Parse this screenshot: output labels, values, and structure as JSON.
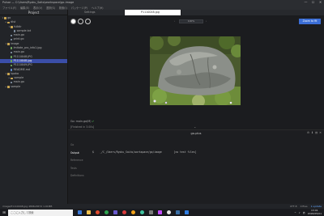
{
  "window": {
    "title": "Pulsar — C:\\Users\\Ryoku_Saito\\workspace\\go-image",
    "minimize": "—",
    "maximize": "☐",
    "close": "✕"
  },
  "menu": [
    "ファイル(F)",
    "編集(E)",
    "表示(V)",
    "選択(S)",
    "検索(I)",
    "パッケージ(P)",
    "ヘルプ(H)"
  ],
  "sidebar": {
    "header": "Project",
    "tree": [
      {
        "label": "go",
        "kind": "folder",
        "depth": 0,
        "twisty": "▾"
      },
      {
        "label": "dist",
        "kind": "folder",
        "depth": 1,
        "twisty": "▸"
      },
      {
        "label": "fulldir",
        "kind": "folder",
        "depth": 2,
        "twisty": "▾"
      },
      {
        "label": "sample.txt",
        "kind": "file",
        "depth": 3,
        "twisty": ""
      },
      {
        "label": "main.go",
        "kind": "file",
        "depth": 2,
        "twisty": ""
      },
      {
        "label": "print.go",
        "kind": "file",
        "depth": 2,
        "twisty": ""
      },
      {
        "label": "image",
        "kind": "folder",
        "depth": 1,
        "twisty": "▾"
      },
      {
        "label": "Imitate_pro_info1.jpg",
        "kind": "img",
        "depth": 2,
        "twisty": ""
      },
      {
        "label": "main.go",
        "kind": "file",
        "depth": 2,
        "twisty": ""
      },
      {
        "label": "P1110048.JPG",
        "kind": "img",
        "depth": 2,
        "twisty": ""
      },
      {
        "label": "P1110048.jpg",
        "kind": "img",
        "depth": 2,
        "twisty": "",
        "selected": true
      },
      {
        "label": "P1110049.JPG",
        "kind": "img",
        "depth": 2,
        "twisty": ""
      },
      {
        "label": "README.md",
        "kind": "md",
        "depth": 2,
        "twisty": ""
      },
      {
        "label": "kpaka",
        "kind": "folder",
        "depth": 1,
        "twisty": "▾"
      },
      {
        "label": "sample",
        "kind": "folder",
        "depth": 2,
        "twisty": "▸"
      },
      {
        "label": "main.go",
        "kind": "file",
        "depth": 2,
        "twisty": ""
      },
      {
        "label": "sample",
        "kind": "folder",
        "depth": 1,
        "twisty": "▸"
      }
    ]
  },
  "tabs": [
    {
      "label": "Settings",
      "active": false
    },
    {
      "label": "P1110048.jpg",
      "active": true
    }
  ],
  "image_toolbar": {
    "zoom_value": "100%",
    "zoom_fit": "Zoom to fit",
    "swatches": [
      "#ffffff",
      "#1b1c1f",
      "#1b1c1f"
    ]
  },
  "git": {
    "label": "Go: main.go(M)",
    "status": "✔"
  },
  "tool_panel": {
    "finished": "[Finished in 3.00s]",
    "header": "go-plus",
    "tabs": [
      "Go",
      "Output",
      "Reference",
      "Tests",
      "Definitions"
    ],
    "active_tab": "Output",
    "output_line": "$    _/C_/Users/Ryoku_Saito/workspace/go/image        [no test files]",
    "icons": [
      "⚙",
      "⬇",
      "▤",
      "✕"
    ]
  },
  "status_bar": {
    "left": "image/P1110048.jpg    4896x3672 1.91MB",
    "encoding": "UTF-8",
    "right_items": [
      "0 files",
      "1 update"
    ]
  },
  "taskbar": {
    "start": "⊞",
    "search_placeholder": "ここに入力して検索",
    "apps": [
      {
        "color": "#3a78d6",
        "shape": "sq"
      },
      {
        "color": "#f2c14e",
        "shape": "sq"
      },
      {
        "color": "#e04b2f",
        "shape": "round"
      },
      {
        "color": "#2da34f",
        "shape": "round"
      },
      {
        "color": "#6a5acd",
        "shape": "sq"
      },
      {
        "color": "#d83b3b",
        "shape": "round"
      },
      {
        "color": "#f2a21b",
        "shape": "round"
      },
      {
        "color": "#40c3a0",
        "shape": "round"
      },
      {
        "color": "#7a7a7a",
        "shape": "sq"
      },
      {
        "color": "#c44dff",
        "shape": "sq"
      },
      {
        "color": "#e8e8e8",
        "shape": "round"
      },
      {
        "color": "#3a6ea5",
        "shape": "sq"
      },
      {
        "color": "#2f7de1",
        "shape": "sq"
      }
    ],
    "tray": [
      "^",
      "♪",
      "あ"
    ],
    "time": "13:01",
    "date": "2018/05/01"
  }
}
